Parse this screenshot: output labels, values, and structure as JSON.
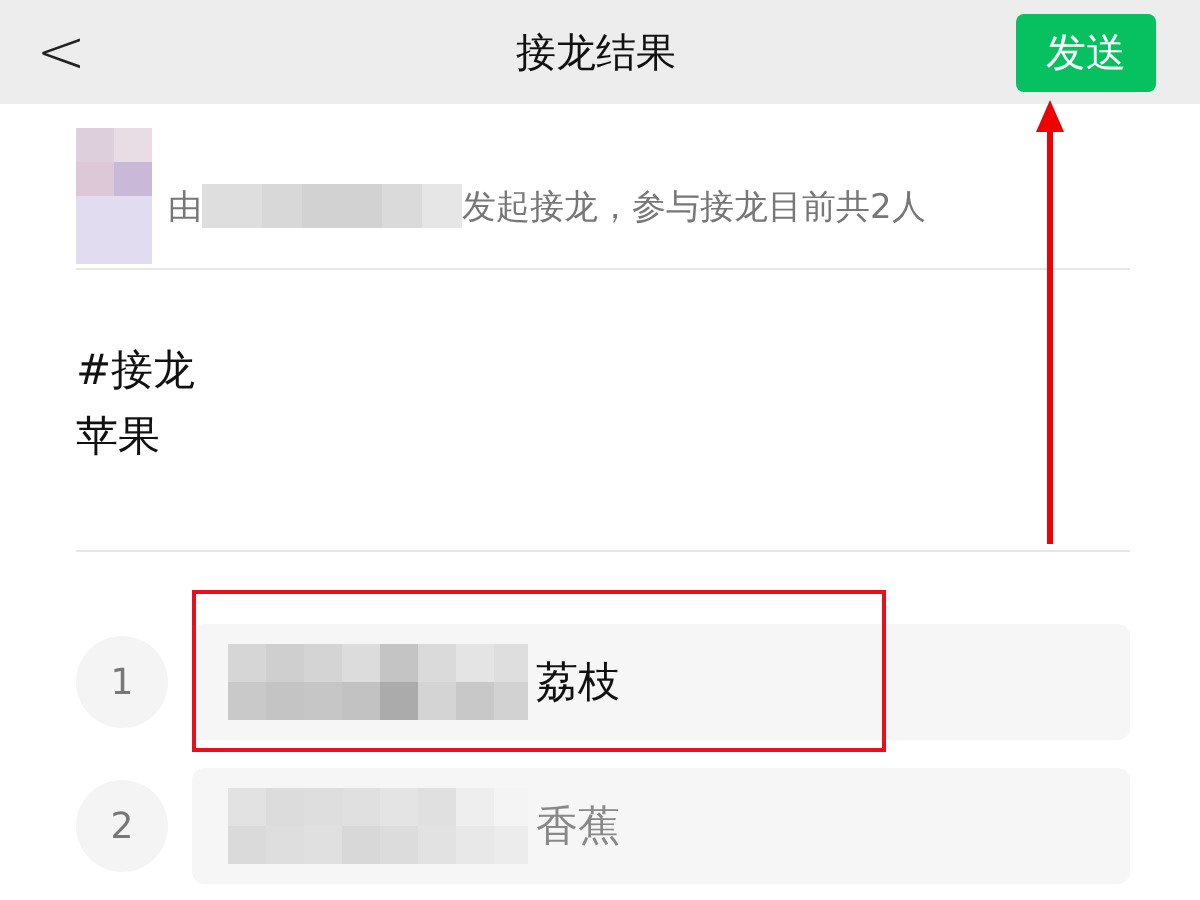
{
  "header": {
    "back": "<",
    "title": "接龙结果",
    "send_button": "发送"
  },
  "initiator": {
    "prefix": "由",
    "suffix": "发起接龙，参与接龙目前共2人"
  },
  "topic": [
    "#接龙",
    "苹果"
  ],
  "entries": [
    {
      "number": "1",
      "text": "荔枝",
      "editing": true
    },
    {
      "number": "2",
      "text": "香蕉",
      "editing": false
    }
  ]
}
